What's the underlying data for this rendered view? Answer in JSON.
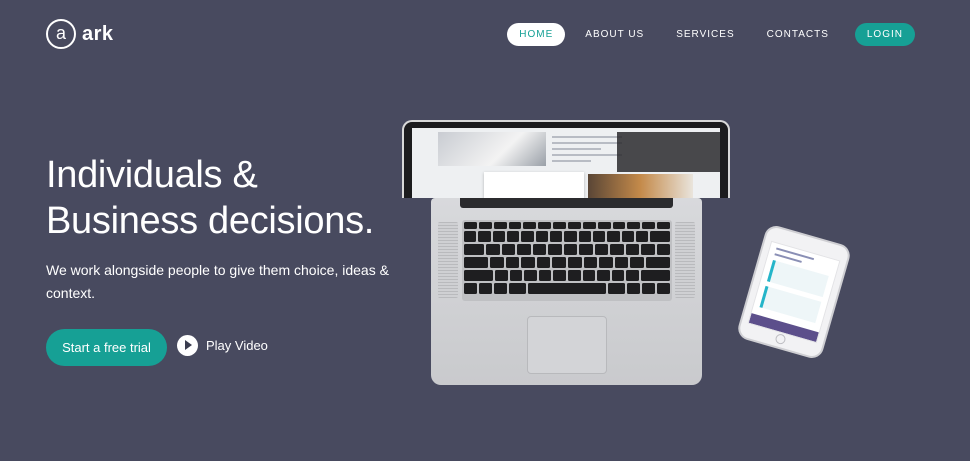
{
  "brand": {
    "mark": "a",
    "name": "ark"
  },
  "nav": {
    "items": [
      {
        "label": "HOME",
        "active": true
      },
      {
        "label": "ABOUT US"
      },
      {
        "label": "SERVICES"
      },
      {
        "label": "CONTACTS"
      }
    ],
    "login_label": "LOGIN"
  },
  "hero": {
    "headline_line1": "Individuals &",
    "headline_line2": "Business decisions.",
    "subtext": "We work alongside people to give them choice, ideas & context.",
    "cta_label": "Start a free trial",
    "play_label": "Play Video",
    "play_icon": "play-icon"
  },
  "colors": {
    "background": "#484a5f",
    "accent": "#16a095",
    "text": "#ffffff"
  }
}
